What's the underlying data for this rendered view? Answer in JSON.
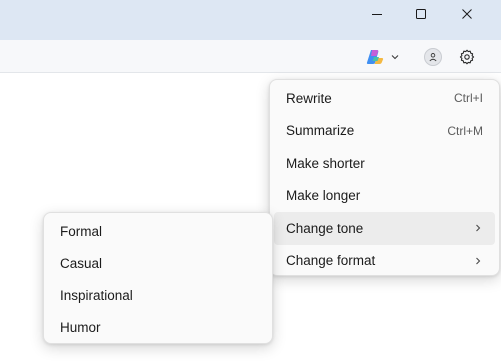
{
  "window_controls": {
    "minimize_icon": "minimize-icon",
    "maximize_icon": "maximize-icon",
    "close_icon": "close-icon"
  },
  "toolbar": {
    "copilot_icon": "copilot-icon",
    "dropdown_icon": "chevron-down-icon",
    "profile_icon": "profile-icon",
    "settings_icon": "gear-icon"
  },
  "main_menu": {
    "items": [
      {
        "label": "Rewrite",
        "shortcut": "Ctrl+I"
      },
      {
        "label": "Summarize",
        "shortcut": "Ctrl+M"
      },
      {
        "label": "Make shorter",
        "shortcut": ""
      },
      {
        "label": "Make longer",
        "shortcut": ""
      },
      {
        "label": "Change tone",
        "shortcut": "",
        "submenu_icon": "chevron-right-icon"
      },
      {
        "label": "Change format",
        "shortcut": "",
        "submenu_icon": "chevron-right-icon"
      }
    ]
  },
  "tone_submenu": {
    "items": [
      {
        "label": "Formal"
      },
      {
        "label": "Casual"
      },
      {
        "label": "Inspirational"
      },
      {
        "label": "Humor"
      }
    ]
  },
  "colors": {
    "titlebar": "#dde7f3",
    "toolbar": "#f7f8fa",
    "menu_bg": "#fafafa",
    "hover": "#ececec"
  }
}
